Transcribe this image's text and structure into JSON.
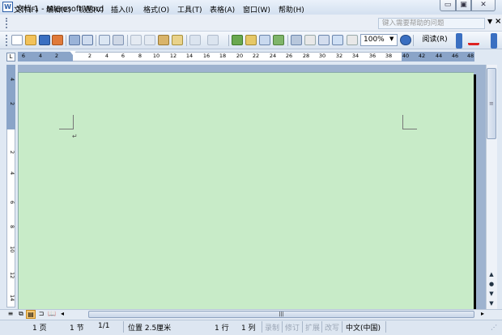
{
  "window": {
    "title": "文档 1 - Microsoft Word",
    "app_icon": "W",
    "minimize": "▭",
    "maximize": "▣",
    "close": "✕"
  },
  "menu": {
    "items": [
      "文件(F)",
      "编辑(E)",
      "视图(V)",
      "插入(I)",
      "格式(O)",
      "工具(T)",
      "表格(A)",
      "窗口(W)",
      "帮助(H)"
    ],
    "help_placeholder": "键入需要帮助的问题",
    "dropdown": "▼",
    "close_doc": "×"
  },
  "toolbar": {
    "zoom": "100%",
    "zoom_dropdown": "▼",
    "read_mode": "阅读(R)",
    "icons": [
      "new-icon",
      "open-icon",
      "save-icon",
      "permission-icon",
      "email-icon",
      "print-icon",
      "print-preview-icon",
      "spelling-icon",
      "research-icon",
      "cut-icon",
      "copy-icon",
      "paste-icon",
      "format-painter-icon",
      "undo-icon",
      "redo-icon",
      "hyperlink-icon",
      "tables-borders-icon",
      "insert-table-icon",
      "insert-excel-icon",
      "columns-icon",
      "drawing-icon",
      "document-map-icon",
      "show-hide-icon",
      "help-icon",
      "font-color-icon"
    ]
  },
  "ruler": {
    "tab_selector": "L",
    "h_numbers": [
      "6",
      "4",
      "2",
      "2",
      "4",
      "6",
      "8",
      "10",
      "12",
      "14",
      "16",
      "18",
      "20",
      "22",
      "24",
      "26",
      "28",
      "30",
      "32",
      "34",
      "36",
      "38",
      "40",
      "42",
      "44",
      "46",
      "48"
    ],
    "v_numbers": [
      "4",
      "2",
      "2",
      "4",
      "6",
      "8",
      "10",
      "12",
      "14"
    ]
  },
  "document": {
    "paragraph_mark": "↵"
  },
  "scroll": {
    "up": "▲",
    "down": "▼",
    "prev_page": "▲",
    "select_browse": "●",
    "next_page": "▼",
    "left": "◂",
    "right": "▸",
    "hgrip": "|||"
  },
  "views": [
    "≡",
    "⧉",
    "▤",
    "⊐",
    "📖"
  ],
  "status": {
    "page": "1 页",
    "section": "1 节",
    "page_of": "1/1",
    "position": "位置 2.5厘米",
    "line": "1 行",
    "column": "1 列",
    "record": "录制",
    "revision": "修订",
    "extend": "扩展",
    "overwrite": "改写",
    "language": "中文(中国)"
  },
  "colors": {
    "page_background": "#c8ebc8",
    "accent": "#2a5da8"
  }
}
